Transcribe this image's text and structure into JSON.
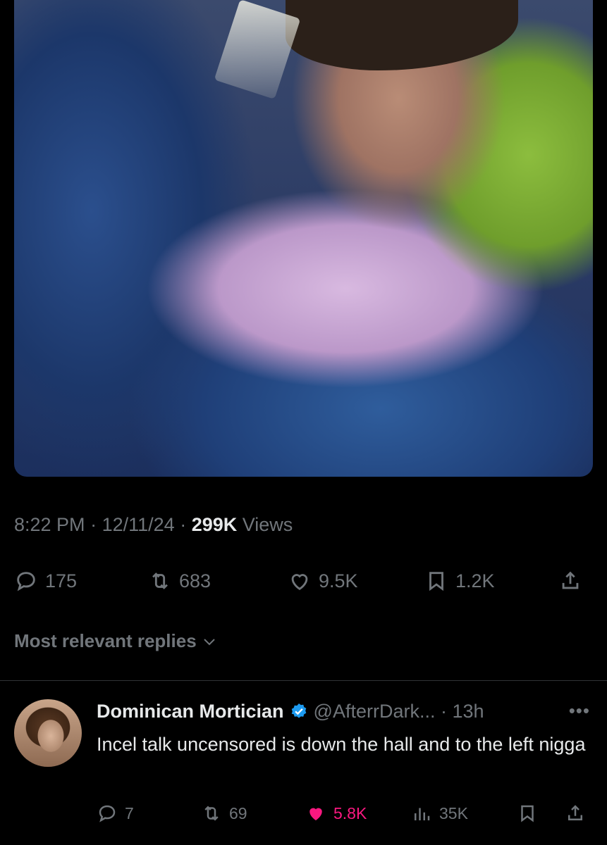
{
  "tweet": {
    "time": "8:22 PM",
    "date": "12/11/24",
    "views_count": "299K",
    "views_label": "Views",
    "replies": "175",
    "reposts": "683",
    "likes": "9.5K",
    "bookmarks": "1.2K"
  },
  "replies_section": {
    "label": "Most relevant replies"
  },
  "reply": {
    "name": "Dominican Mortician",
    "handle": "@AfterrDark...",
    "age": "13h",
    "text": "Incel talk uncensored is down the hall and to the left nigga",
    "replies": "7",
    "reposts": "69",
    "likes": "5.8K",
    "views": "35K",
    "verified_color": "#1d9bf0",
    "like_color": "#f91880"
  },
  "icons": [
    "reply-icon",
    "repost-icon",
    "like-icon",
    "bookmark-icon",
    "share-icon",
    "chevron-down-icon",
    "verified-badge-icon",
    "more-icon",
    "views-icon"
  ]
}
